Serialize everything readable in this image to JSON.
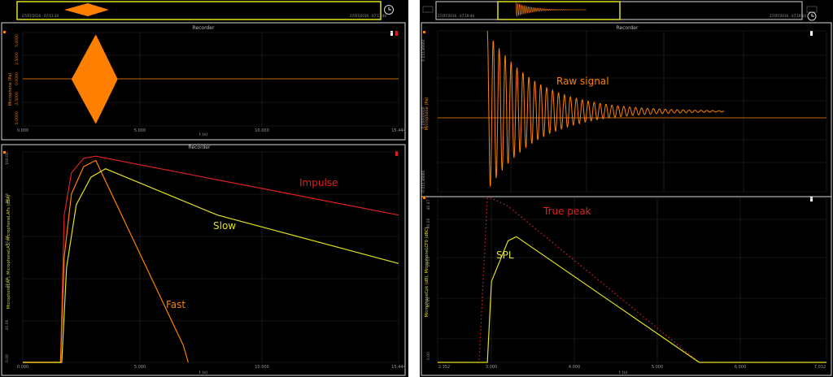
{
  "colors": {
    "background": "#000000",
    "panel_border": "#d8d8d8",
    "title_bar": "#101010",
    "grid": "#2a2a2a",
    "signal": "#ff8000",
    "impulse": "#e02020",
    "fast": "#ff8000",
    "slow": "#e0e020",
    "overview_frame": "#e0e020",
    "axis_text": "#9a9a9a"
  },
  "left": {
    "overview": {
      "start_time": "27/07/2016 - 07:13:30",
      "end_time": "27/07/2016 - 07:13:46",
      "icon": "clock-icon"
    },
    "top_chart": {
      "title": "Recorder",
      "ylabel": "Microphone (Pa)",
      "yticks": [
        "5.0000",
        "2.5000",
        "0.0000",
        "-2.5000",
        "-5.0000"
      ],
      "xticks": [
        "0.000",
        "5.000",
        "10.000",
        "15.444"
      ],
      "xlabel": "t (s)"
    },
    "bottom_chart": {
      "title": "Recorder",
      "ylabel": "MicrophoneLAFi, MicrophoneLAS, MicrophoneLAFs (dBA)",
      "yticks": [
        "100.00",
        "80.00",
        "60.00",
        "40.00",
        "20.00",
        "0.00"
      ],
      "xticks": [
        "0.000",
        "5.000",
        "10.000",
        "15.444"
      ],
      "xlabel": "t (s)",
      "labels": {
        "impulse": "Impulse",
        "slow": "Slow",
        "fast": "Fast"
      }
    }
  },
  "right": {
    "overview": {
      "start_time": "27/07/2016 - 07:19:40",
      "end_time": "27/07/2016 - 07:19:50",
      "icon": "clock-icon"
    },
    "top_chart": {
      "title": "Recorder",
      "ylabel": "Microphone (Pa)",
      "yticks": [
        "0.01136660",
        "0.00000000",
        "-0.01136660"
      ],
      "label": "Raw signal"
    },
    "bottom_chart": {
      "ylabel": "MicrophoneCpk (dB), MicrophoneLCF0 (dBC)",
      "yticks": [
        "40.47",
        "30.00",
        "20.00",
        "10.00",
        "0.00"
      ],
      "xticks": [
        "2.352",
        "3.000",
        "4.000",
        "5.000",
        "6.000",
        "7.032"
      ],
      "xlabel": "t (s)",
      "labels": {
        "true_peak": "True peak",
        "spl": "SPL"
      }
    }
  },
  "chart_data": [
    {
      "type": "line",
      "title": "Recorder",
      "ylabel": "Microphone (Pa)",
      "xlabel": "t (s)",
      "xlim": [
        0,
        15.444
      ],
      "ylim": [
        -5,
        5
      ],
      "series": [
        {
          "envelope": {
            "x": [
              2.0,
              3.0,
              3.9
            ],
            "y_max": [
              0,
              4.8,
              0
            ]
          }
        }
      ]
    },
    {
      "type": "line",
      "title": "Recorder",
      "xlabel": "t (s)",
      "xlim": [
        0,
        15.444
      ],
      "ylim": [
        0,
        100
      ],
      "series": [
        {
          "name": "Impulse",
          "x": [
            1.55,
            1.7,
            2.0,
            2.5,
            3.0,
            15.444
          ],
          "y": [
            0,
            70,
            90,
            97,
            98,
            70
          ]
        },
        {
          "name": "Fast",
          "x": [
            1.55,
            1.7,
            2.0,
            2.5,
            3.0,
            6.6,
            6.8
          ],
          "y": [
            0,
            50,
            80,
            93,
            96,
            8,
            0
          ]
        },
        {
          "name": "Slow",
          "x": [
            1.6,
            1.8,
            2.2,
            2.8,
            3.4,
            8.0,
            15.444
          ],
          "y": [
            0,
            45,
            75,
            88,
            92,
            70,
            47
          ]
        }
      ]
    },
    {
      "type": "line",
      "title": "Recorder",
      "ylabel": "Microphone (Pa)",
      "ylim": [
        -0.0113666,
        0.0113666
      ],
      "series": [
        {
          "name": "Raw signal",
          "decaying_oscillation": {
            "start": 2.95,
            "peak": 0.0113666,
            "end": 5.8
          }
        }
      ]
    },
    {
      "type": "line",
      "xlabel": "t (s)",
      "xlim": [
        2.352,
        7.032
      ],
      "ylim": [
        0,
        40.47
      ],
      "series": [
        {
          "name": "True peak",
          "x": [
            2.85,
            2.95,
            3.0,
            3.2,
            5.5,
            7.032
          ],
          "y": [
            0,
            40.47,
            40.47,
            38.5,
            0,
            0
          ]
        },
        {
          "name": "SPL",
          "x": [
            2.95,
            3.0,
            3.2,
            3.3,
            5.5,
            7.032
          ],
          "y": [
            0,
            20,
            30,
            31,
            0,
            0
          ]
        }
      ]
    }
  ]
}
